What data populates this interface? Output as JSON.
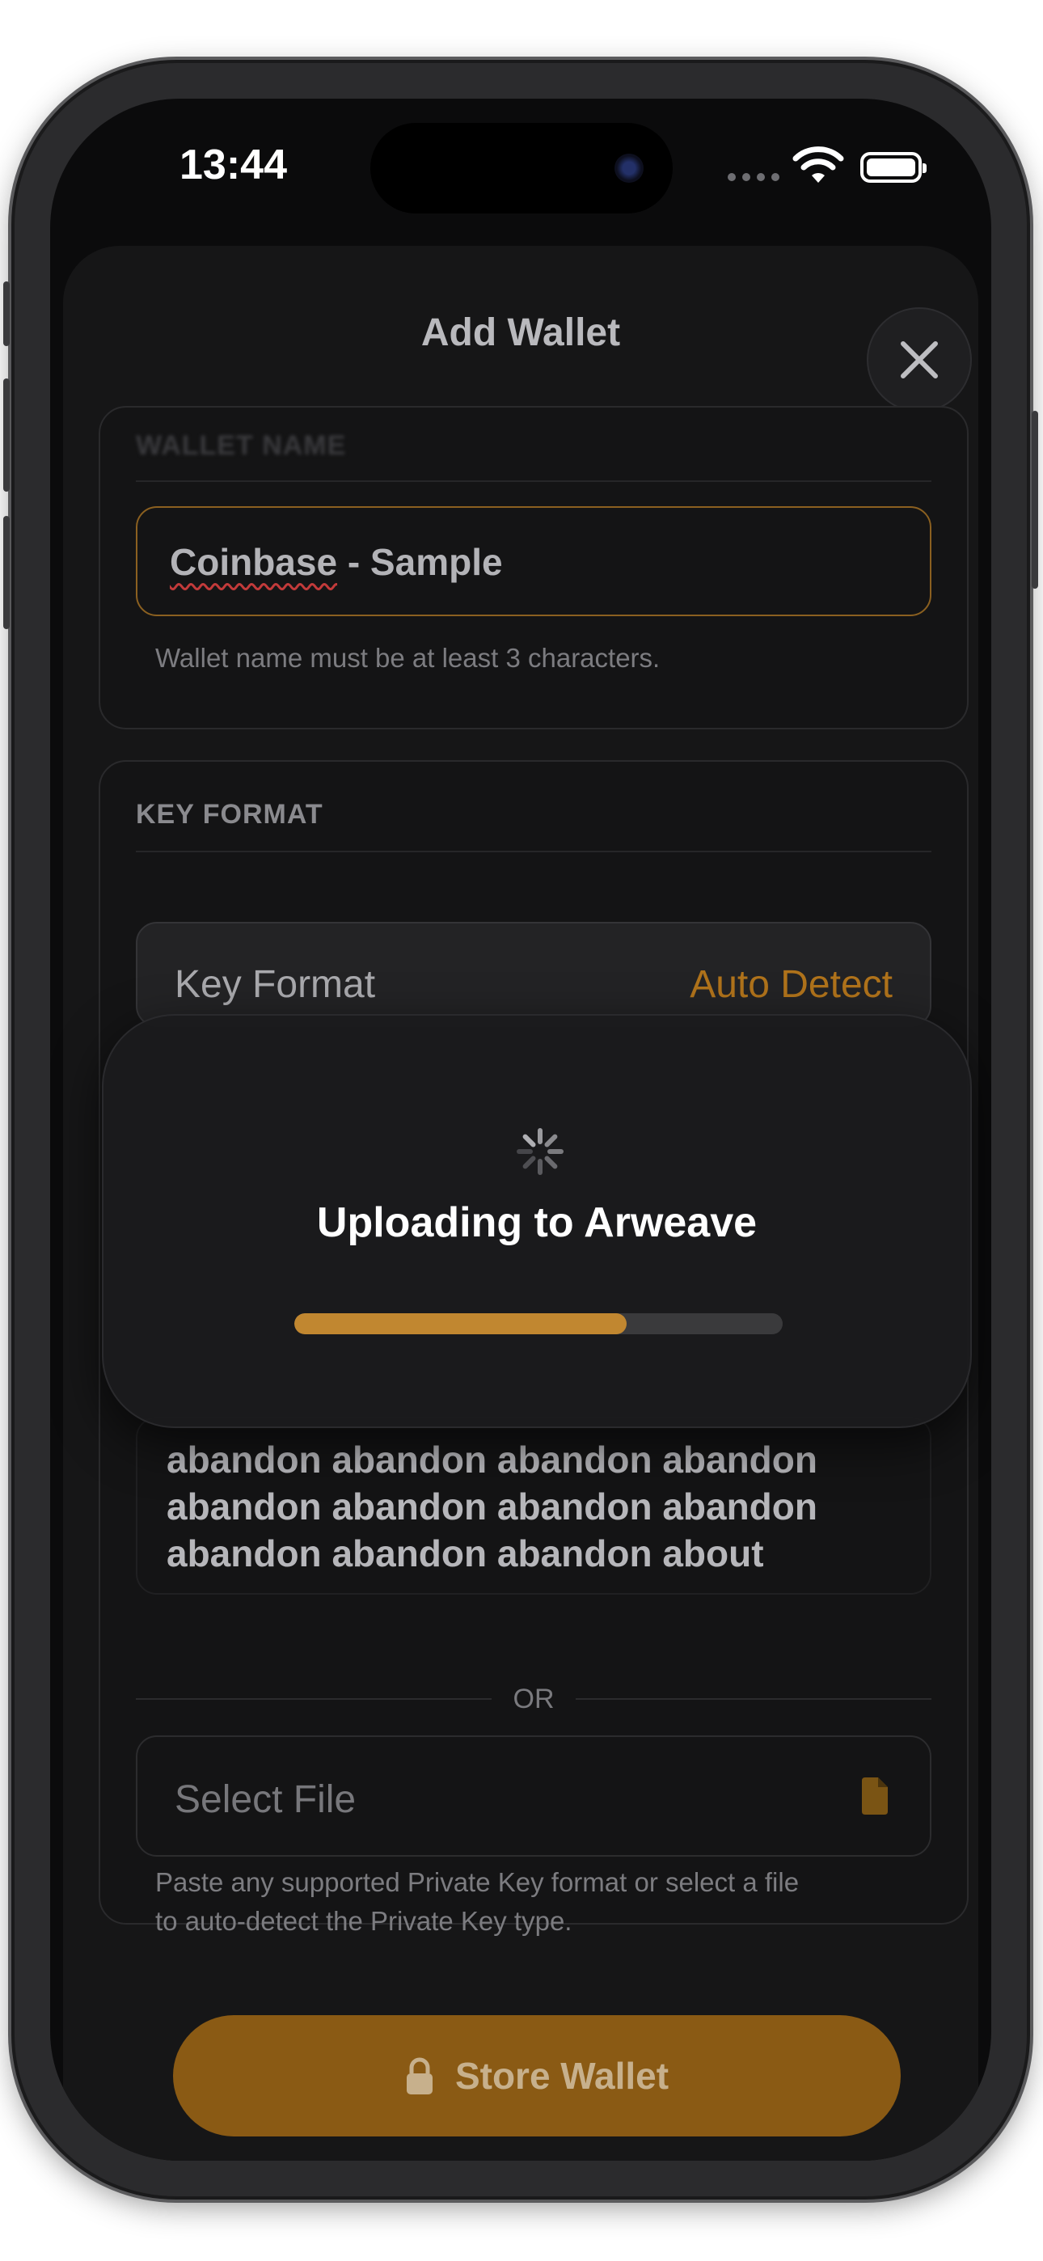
{
  "status_bar": {
    "time": "13:44"
  },
  "sheet": {
    "title": "Add Wallet",
    "wallet_name": {
      "label": "WALLET NAME",
      "value_word1": "Coinbase",
      "value_rest": " - Sample",
      "hint": "Wallet name must be at least 3 characters."
    },
    "key_format": {
      "section_label": "KEY FORMAT",
      "row_label": "Key Format",
      "row_value": "Auto Detect",
      "phrase_lines": [
        "abandon abandon abandon abandon",
        "abandon abandon abandon abandon",
        "abandon abandon abandon about"
      ],
      "or_label": "OR",
      "file_placeholder": "Select File",
      "hint_lines": [
        "Paste any supported Private Key format or select a file",
        "to auto-detect the Private Key type."
      ]
    },
    "store_button": "Store Wallet"
  },
  "loading": {
    "title": "Uploading to Arweave",
    "progress": 0.68
  },
  "colors": {
    "accent": "#c18730",
    "accent_text": "#b0731b",
    "button_bg": "#8a5a14"
  },
  "icons": [
    "close-icon",
    "spinner-icon",
    "document-icon",
    "lock-icon",
    "wifi-icon",
    "battery-icon"
  ]
}
